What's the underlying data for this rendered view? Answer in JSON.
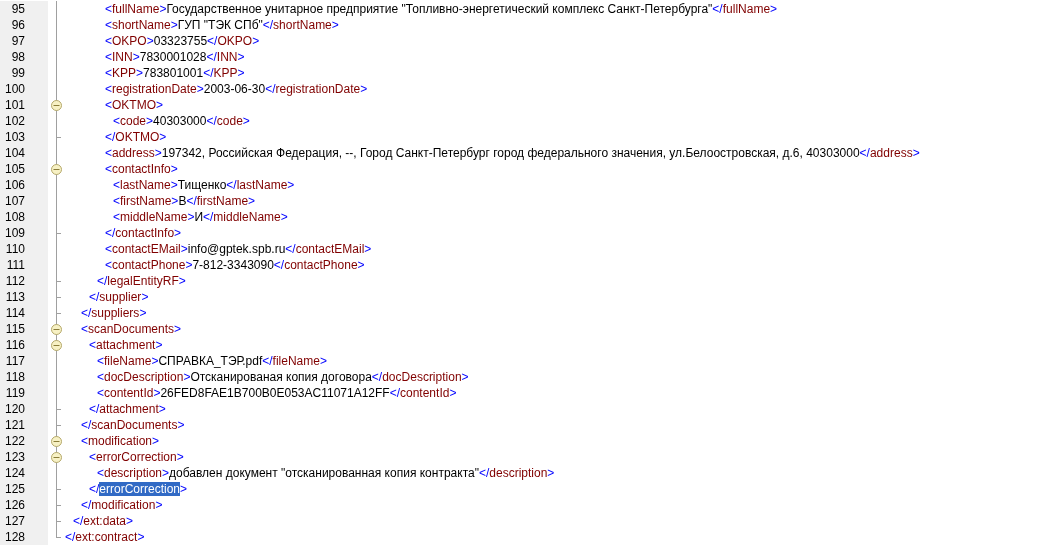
{
  "lines": [
    {
      "children": [
        {
          "children": [
            {
              "children": [
                {
                  "children": [
                    {
                      "children": [
                        {
                          "num": "95",
                          "kind": "plain",
                          "tokens": [
                            {
                              "kind": "bracket",
                              "text": "<"
                            },
                            {
                              "kind": "name",
                              "text": "fullName"
                            },
                            {
                              "kind": "bracket",
                              "text": ">"
                            },
                            {
                              "kind": "text",
                              "text": "Государственное унитарное предприятие \"Топливно-энергетический комплекс Санкт-Петербурга\""
                            },
                            {
                              "kind": "bracket",
                              "text": "</"
                            },
                            {
                              "kind": "name",
                              "text": "fullName"
                            },
                            {
                              "kind": "bracket",
                              "text": ">"
                            }
                          ]
                        },
                        {
                          "num": "96",
                          "kind": "plain",
                          "tokens": [
                            {
                              "kind": "bracket",
                              "text": "<"
                            },
                            {
                              "kind": "name",
                              "text": "shortName"
                            },
                            {
                              "kind": "bracket",
                              "text": ">"
                            },
                            {
                              "kind": "text",
                              "text": "ГУП \"ТЭК СПб\""
                            },
                            {
                              "kind": "bracket",
                              "text": "</"
                            },
                            {
                              "kind": "name",
                              "text": "shortName"
                            },
                            {
                              "kind": "bracket",
                              "text": ">"
                            }
                          ]
                        },
                        {
                          "num": "97",
                          "kind": "plain",
                          "tokens": [
                            {
                              "kind": "bracket",
                              "text": "<"
                            },
                            {
                              "kind": "name",
                              "text": "OKPO"
                            },
                            {
                              "kind": "bracket",
                              "text": ">"
                            },
                            {
                              "kind": "text",
                              "text": "03323755"
                            },
                            {
                              "kind": "bracket",
                              "text": "</"
                            },
                            {
                              "kind": "name",
                              "text": "OKPO"
                            },
                            {
                              "kind": "bracket",
                              "text": ">"
                            }
                          ]
                        },
                        {
                          "num": "98",
                          "kind": "plain",
                          "tokens": [
                            {
                              "kind": "bracket",
                              "text": "<"
                            },
                            {
                              "kind": "name",
                              "text": "INN"
                            },
                            {
                              "kind": "bracket",
                              "text": ">"
                            },
                            {
                              "kind": "text",
                              "text": "7830001028"
                            },
                            {
                              "kind": "bracket",
                              "text": "</"
                            },
                            {
                              "kind": "name",
                              "text": "INN"
                            },
                            {
                              "kind": "bracket",
                              "text": ">"
                            }
                          ]
                        },
                        {
                          "num": "99",
                          "kind": "plain",
                          "tokens": [
                            {
                              "kind": "bracket",
                              "text": "<"
                            },
                            {
                              "kind": "name",
                              "text": "KPP"
                            },
                            {
                              "kind": "bracket",
                              "text": ">"
                            },
                            {
                              "kind": "text",
                              "text": "783801001"
                            },
                            {
                              "kind": "bracket",
                              "text": "</"
                            },
                            {
                              "kind": "name",
                              "text": "KPP"
                            },
                            {
                              "kind": "bracket",
                              "text": ">"
                            }
                          ]
                        },
                        {
                          "num": "100",
                          "kind": "plain",
                          "tokens": [
                            {
                              "kind": "bracket",
                              "text": "<"
                            },
                            {
                              "kind": "name",
                              "text": "registrationDate"
                            },
                            {
                              "kind": "bracket",
                              "text": ">"
                            },
                            {
                              "kind": "text",
                              "text": "2003-06-30"
                            },
                            {
                              "kind": "bracket",
                              "text": "</"
                            },
                            {
                              "kind": "name",
                              "text": "registrationDate"
                            },
                            {
                              "kind": "bracket",
                              "text": ">"
                            }
                          ]
                        },
                        {
                          "num": "101",
                          "kind": "open",
                          "tokens": [
                            {
                              "kind": "bracket",
                              "text": "<"
                            },
                            {
                              "kind": "name",
                              "text": "OKTMO"
                            },
                            {
                              "kind": "bracket",
                              "text": ">"
                            }
                          ],
                          "children": [
                            {
                              "num": "102",
                              "kind": "plain",
                              "tokens": [
                                {
                                  "kind": "bracket",
                                  "text": "<"
                                },
                                {
                                  "kind": "name",
                                  "text": "code"
                                },
                                {
                                  "kind": "bracket",
                                  "text": ">"
                                },
                                {
                                  "kind": "text",
                                  "text": "40303000"
                                },
                                {
                                  "kind": "bracket",
                                  "text": "</"
                                },
                                {
                                  "kind": "name",
                                  "text": "code"
                                },
                                {
                                  "kind": "bracket",
                                  "text": ">"
                                }
                              ]
                            }
                          ]
                        },
                        {
                          "num": "103",
                          "kind": "end",
                          "tokens": [
                            {
                              "kind": "bracket",
                              "text": "</"
                            },
                            {
                              "kind": "name",
                              "text": "OKTMO"
                            },
                            {
                              "kind": "bracket",
                              "text": ">"
                            }
                          ]
                        },
                        {
                          "num": "104",
                          "kind": "plain",
                          "tokens": [
                            {
                              "kind": "bracket",
                              "text": "<"
                            },
                            {
                              "kind": "name",
                              "text": "address"
                            },
                            {
                              "kind": "bracket",
                              "text": ">"
                            },
                            {
                              "kind": "text",
                              "text": "197342, Российская Федерация, --, Город Санкт-Петербург город федерального значения, ул.Белоостровская, д.6, 40303000"
                            },
                            {
                              "kind": "bracket",
                              "text": "</"
                            },
                            {
                              "kind": "name",
                              "text": "address"
                            },
                            {
                              "kind": "bracket",
                              "text": ">"
                            }
                          ]
                        },
                        {
                          "num": "105",
                          "kind": "open",
                          "tokens": [
                            {
                              "kind": "bracket",
                              "text": "<"
                            },
                            {
                              "kind": "name",
                              "text": "contactInfo"
                            },
                            {
                              "kind": "bracket",
                              "text": ">"
                            }
                          ],
                          "children": [
                            {
                              "num": "106",
                              "kind": "plain",
                              "tokens": [
                                {
                                  "kind": "bracket",
                                  "text": "<"
                                },
                                {
                                  "kind": "name",
                                  "text": "lastName"
                                },
                                {
                                  "kind": "bracket",
                                  "text": ">"
                                },
                                {
                                  "kind": "text",
                                  "text": "Тищенко"
                                },
                                {
                                  "kind": "bracket",
                                  "text": "</"
                                },
                                {
                                  "kind": "name",
                                  "text": "lastName"
                                },
                                {
                                  "kind": "bracket",
                                  "text": ">"
                                }
                              ]
                            },
                            {
                              "num": "107",
                              "kind": "plain",
                              "tokens": [
                                {
                                  "kind": "bracket",
                                  "text": "<"
                                },
                                {
                                  "kind": "name",
                                  "text": "firstName"
                                },
                                {
                                  "kind": "bracket",
                                  "text": ">"
                                },
                                {
                                  "kind": "text",
                                  "text": "В"
                                },
                                {
                                  "kind": "bracket",
                                  "text": "</"
                                },
                                {
                                  "kind": "name",
                                  "text": "firstName"
                                },
                                {
                                  "kind": "bracket",
                                  "text": ">"
                                }
                              ]
                            },
                            {
                              "num": "108",
                              "kind": "plain",
                              "tokens": [
                                {
                                  "kind": "bracket",
                                  "text": "<"
                                },
                                {
                                  "kind": "name",
                                  "text": "middleName"
                                },
                                {
                                  "kind": "bracket",
                                  "text": ">"
                                },
                                {
                                  "kind": "text",
                                  "text": "И"
                                },
                                {
                                  "kind": "bracket",
                                  "text": "</"
                                },
                                {
                                  "kind": "name",
                                  "text": "middleName"
                                },
                                {
                                  "kind": "bracket",
                                  "text": ">"
                                }
                              ]
                            }
                          ]
                        },
                        {
                          "num": "109",
                          "kind": "end",
                          "tokens": [
                            {
                              "kind": "bracket",
                              "text": "</"
                            },
                            {
                              "kind": "name",
                              "text": "contactInfo"
                            },
                            {
                              "kind": "bracket",
                              "text": ">"
                            }
                          ]
                        },
                        {
                          "num": "110",
                          "kind": "plain",
                          "tokens": [
                            {
                              "kind": "bracket",
                              "text": "<"
                            },
                            {
                              "kind": "name",
                              "text": "contactEMail"
                            },
                            {
                              "kind": "bracket",
                              "text": ">"
                            },
                            {
                              "kind": "text",
                              "text": "info@gptek.spb.ru"
                            },
                            {
                              "kind": "bracket",
                              "text": "</"
                            },
                            {
                              "kind": "name",
                              "text": "contactEMail"
                            },
                            {
                              "kind": "bracket",
                              "text": ">"
                            }
                          ]
                        },
                        {
                          "num": "111",
                          "kind": "plain",
                          "tokens": [
                            {
                              "kind": "bracket",
                              "text": "<"
                            },
                            {
                              "kind": "name",
                              "text": "contactPhone"
                            },
                            {
                              "kind": "bracket",
                              "text": ">"
                            },
                            {
                              "kind": "text",
                              "text": "7-812-3343090"
                            },
                            {
                              "kind": "bracket",
                              "text": "</"
                            },
                            {
                              "kind": "name",
                              "text": "contactPhone"
                            },
                            {
                              "kind": "bracket",
                              "text": ">"
                            }
                          ]
                        }
                      ]
                    },
                    {
                      "num": "112",
                      "kind": "end",
                      "tokens": [
                        {
                          "kind": "bracket",
                          "text": "</"
                        },
                        {
                          "kind": "name",
                          "text": "legalEntityRF"
                        },
                        {
                          "kind": "bracket",
                          "text": ">"
                        }
                      ]
                    }
                  ]
                },
                {
                  "num": "113",
                  "kind": "end",
                  "tokens": [
                    {
                      "kind": "bracket",
                      "text": "</"
                    },
                    {
                      "kind": "name",
                      "text": "supplier"
                    },
                    {
                      "kind": "bracket",
                      "text": ">"
                    }
                  ]
                }
              ]
            },
            {
              "num": "114",
              "kind": "end",
              "tokens": [
                {
                  "kind": "bracket",
                  "text": "</"
                },
                {
                  "kind": "name",
                  "text": "suppliers"
                },
                {
                  "kind": "bracket",
                  "text": ">"
                }
              ]
            },
            {
              "num": "115",
              "kind": "open",
              "tokens": [
                {
                  "kind": "bracket",
                  "text": "<"
                },
                {
                  "kind": "name",
                  "text": "scanDocuments"
                },
                {
                  "kind": "bracket",
                  "text": ">"
                }
              ],
              "children": [
                {
                  "num": "116",
                  "kind": "open",
                  "tokens": [
                    {
                      "kind": "bracket",
                      "text": "<"
                    },
                    {
                      "kind": "name",
                      "text": "attachment"
                    },
                    {
                      "kind": "bracket",
                      "text": ">"
                    }
                  ],
                  "children": [
                    {
                      "num": "117",
                      "kind": "plain",
                      "tokens": [
                        {
                          "kind": "bracket",
                          "text": "<"
                        },
                        {
                          "kind": "name",
                          "text": "fileName"
                        },
                        {
                          "kind": "bracket",
                          "text": ">"
                        },
                        {
                          "kind": "text",
                          "text": "СПРАВКА_ТЭР.pdf"
                        },
                        {
                          "kind": "bracket",
                          "text": "</"
                        },
                        {
                          "kind": "name",
                          "text": "fileName"
                        },
                        {
                          "kind": "bracket",
                          "text": ">"
                        }
                      ]
                    },
                    {
                      "num": "118",
                      "kind": "plain",
                      "tokens": [
                        {
                          "kind": "bracket",
                          "text": "<"
                        },
                        {
                          "kind": "name",
                          "text": "docDescription"
                        },
                        {
                          "kind": "bracket",
                          "text": ">"
                        },
                        {
                          "kind": "text",
                          "text": "Отсканированая копия договора"
                        },
                        {
                          "kind": "bracket",
                          "text": "</"
                        },
                        {
                          "kind": "name",
                          "text": "docDescription"
                        },
                        {
                          "kind": "bracket",
                          "text": ">"
                        }
                      ]
                    },
                    {
                      "num": "119",
                      "kind": "plain",
                      "tokens": [
                        {
                          "kind": "bracket",
                          "text": "<"
                        },
                        {
                          "kind": "name",
                          "text": "contentId"
                        },
                        {
                          "kind": "bracket",
                          "text": ">"
                        },
                        {
                          "kind": "text",
                          "text": "26FED8FAE1B700B0E053AC11071A12FF"
                        },
                        {
                          "kind": "bracket",
                          "text": "</"
                        },
                        {
                          "kind": "name",
                          "text": "contentId"
                        },
                        {
                          "kind": "bracket",
                          "text": ">"
                        }
                      ]
                    }
                  ]
                },
                {
                  "num": "120",
                  "kind": "end",
                  "tokens": [
                    {
                      "kind": "bracket",
                      "text": "</"
                    },
                    {
                      "kind": "name",
                      "text": "attachment"
                    },
                    {
                      "kind": "bracket",
                      "text": ">"
                    }
                  ]
                }
              ]
            },
            {
              "num": "121",
              "kind": "end",
              "tokens": [
                {
                  "kind": "bracket",
                  "text": "</"
                },
                {
                  "kind": "name",
                  "text": "scanDocuments"
                },
                {
                  "kind": "bracket",
                  "text": ">"
                }
              ]
            },
            {
              "num": "122",
              "kind": "open",
              "tokens": [
                {
                  "kind": "bracket",
                  "text": "<"
                },
                {
                  "kind": "name",
                  "text": "modification"
                },
                {
                  "kind": "bracket",
                  "text": ">"
                }
              ],
              "children": [
                {
                  "num": "123",
                  "kind": "open",
                  "tokens": [
                    {
                      "kind": "bracket",
                      "text": "<"
                    },
                    {
                      "kind": "name",
                      "text": "errorCorrection"
                    },
                    {
                      "kind": "bracket",
                      "text": ">"
                    }
                  ],
                  "children": [
                    {
                      "num": "124",
                      "kind": "plain",
                      "tokens": [
                        {
                          "kind": "bracket",
                          "text": "<"
                        },
                        {
                          "kind": "name",
                          "text": "description"
                        },
                        {
                          "kind": "bracket",
                          "text": ">"
                        },
                        {
                          "kind": "text",
                          "text": "добавлен документ \"отсканированная копия контракта\""
                        },
                        {
                          "kind": "bracket",
                          "text": "</"
                        },
                        {
                          "kind": "name",
                          "text": "description"
                        },
                        {
                          "kind": "bracket",
                          "text": ">"
                        }
                      ]
                    }
                  ]
                },
                {
                  "num": "125",
                  "kind": "end",
                  "tokens": [
                    {
                      "kind": "bracket",
                      "text": "</"
                    },
                    {
                      "kind": "name",
                      "text": "errorCorrection",
                      "selected": true
                    },
                    {
                      "kind": "bracket",
                      "text": ">"
                    }
                  ]
                }
              ]
            },
            {
              "num": "126",
              "kind": "end",
              "tokens": [
                {
                  "kind": "bracket",
                  "text": "</"
                },
                {
                  "kind": "name",
                  "text": "modification"
                },
                {
                  "kind": "bracket",
                  "text": ">"
                }
              ]
            }
          ]
        },
        {
          "num": "127",
          "kind": "end",
          "tokens": [
            {
              "kind": "bracket",
              "text": "</"
            },
            {
              "kind": "name",
              "text": "ext:data"
            },
            {
              "kind": "bracket",
              "text": ">"
            }
          ]
        }
      ]
    },
    {
      "num": "128",
      "kind": "last",
      "tokens": [
        {
          "kind": "bracket",
          "text": "</"
        },
        {
          "kind": "name",
          "text": "ext:contract"
        },
        {
          "kind": "bracket",
          "text": ">"
        }
      ]
    }
  ]
}
